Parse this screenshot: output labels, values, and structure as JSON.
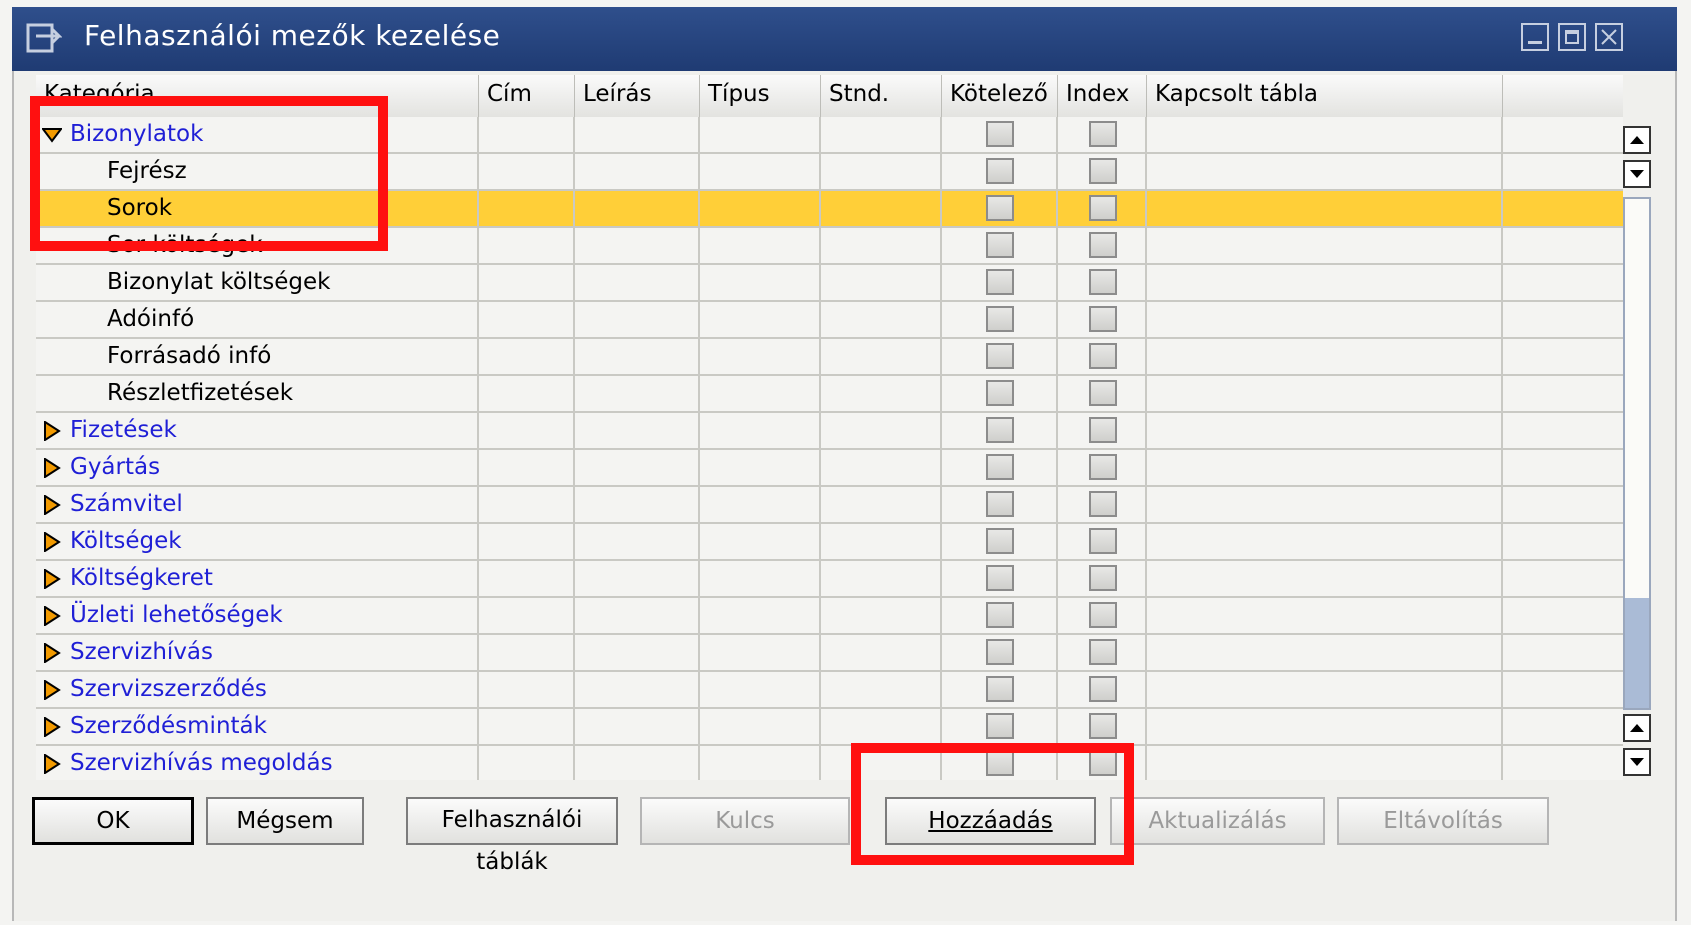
{
  "window": {
    "title": "Felhasználói mezők kezelése"
  },
  "columns": [
    {
      "label": "Kategória"
    },
    {
      "label": "Cím"
    },
    {
      "label": "Leírás"
    },
    {
      "label": "Típus"
    },
    {
      "label": "Stnd."
    },
    {
      "label": "Kötelező"
    },
    {
      "label": "Index"
    },
    {
      "label": "Kapcsolt tábla"
    }
  ],
  "rows": [
    {
      "label": "Bizonylatok",
      "group": true,
      "expanded": true
    },
    {
      "label": "Fejrész",
      "group": false
    },
    {
      "label": "Sorok",
      "group": false,
      "selected": true
    },
    {
      "label": "Sor költségek",
      "group": false
    },
    {
      "label": "Bizonylat költségek",
      "group": false
    },
    {
      "label": "Adóinfó",
      "group": false
    },
    {
      "label": "Forrásadó infó",
      "group": false
    },
    {
      "label": "Részletfizetések",
      "group": false
    },
    {
      "label": "Fizetések",
      "group": true,
      "expanded": false
    },
    {
      "label": "Gyártás",
      "group": true,
      "expanded": false
    },
    {
      "label": "Számvitel",
      "group": true,
      "expanded": false
    },
    {
      "label": "Költségek",
      "group": true,
      "expanded": false
    },
    {
      "label": "Költségkeret",
      "group": true,
      "expanded": false
    },
    {
      "label": "Üzleti lehetőségek",
      "group": true,
      "expanded": false
    },
    {
      "label": "Szervizhívás",
      "group": true,
      "expanded": false
    },
    {
      "label": "Szervizszerződés",
      "group": true,
      "expanded": false
    },
    {
      "label": "Szerződésminták",
      "group": true,
      "expanded": false
    },
    {
      "label": "Szervizhívás megoldás",
      "group": true,
      "expanded": false
    }
  ],
  "buttons": {
    "ok": "OK",
    "cancel": "Mégsem",
    "user_tables": "Felhasználói táblák",
    "key": "Kulcs",
    "add": "Hozzáadás",
    "update": "Aktualizálás",
    "remove": "Eltávolítás"
  },
  "colors": {
    "titlebar": "#1f3b73",
    "selected_row": "#ffcf38",
    "group_text": "#1f1fd6",
    "expander": "#f29a00",
    "highlight_box": "#ff1010"
  }
}
